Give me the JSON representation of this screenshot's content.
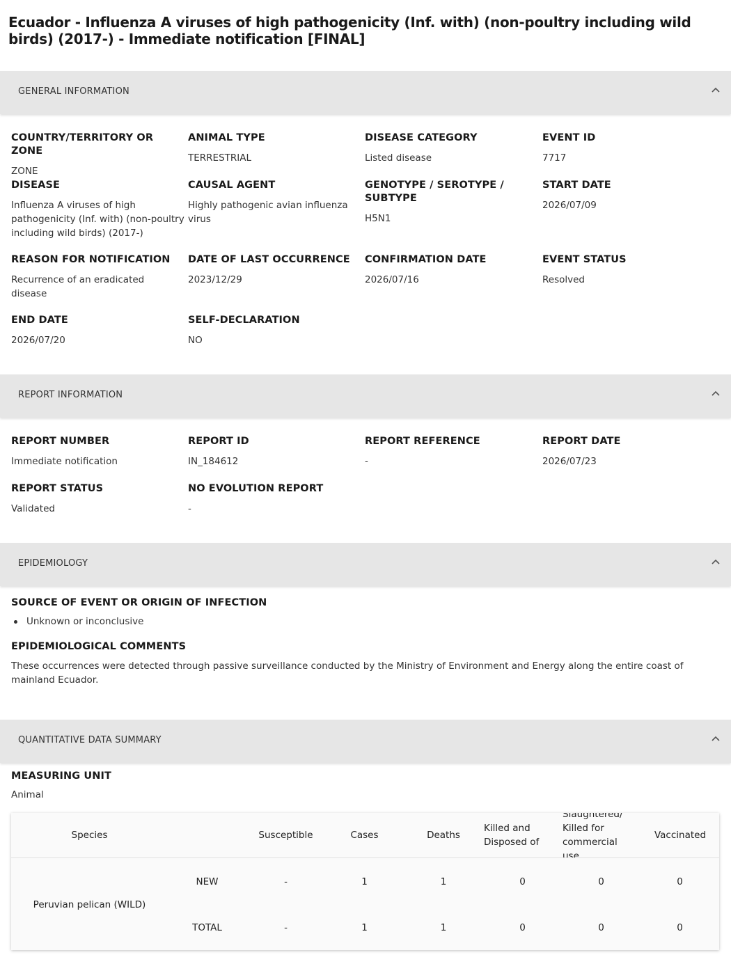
{
  "page": {
    "title": "Ecuador - Influenza A viruses of high pathogenicity (Inf. with) (non-poultry including wild birds) (2017-) - Immediate notification [FINAL]"
  },
  "sections": {
    "general": "GENERAL INFORMATION",
    "report": "REPORT INFORMATION",
    "epidemiology": "EPIDEMIOLOGY",
    "quantitative": "QUANTITATIVE DATA SUMMARY"
  },
  "general": {
    "country": {
      "label": "COUNTRY/TERRITORY OR ZONE",
      "value": "ZONE"
    },
    "animal_type": {
      "label": "ANIMAL TYPE",
      "value": "TERRESTRIAL"
    },
    "disease_category": {
      "label": "DISEASE CATEGORY",
      "value": "Listed disease"
    },
    "event_id": {
      "label": "EVENT ID",
      "value": "7717"
    },
    "disease": {
      "label": "DISEASE",
      "value": "Influenza A viruses of high pathogenicity (Inf. with) (non-poultry including wild birds) (2017-)"
    },
    "causal_agent": {
      "label": "CAUSAL AGENT",
      "value": "Highly pathogenic avian influenza virus"
    },
    "genotype": {
      "label": "GENOTYPE / SEROTYPE / SUBTYPE",
      "value": "H5N1"
    },
    "start_date": {
      "label": "START DATE",
      "value": "2026/07/09"
    },
    "reason": {
      "label": "REASON FOR NOTIFICATION",
      "value": "Recurrence of an eradicated disease"
    },
    "last_occurrence": {
      "label": "DATE OF LAST OCCURRENCE",
      "value": "2023/12/29"
    },
    "confirmation_date": {
      "label": "CONFIRMATION DATE",
      "value": "2026/07/16"
    },
    "event_status": {
      "label": "EVENT STATUS",
      "value": "Resolved"
    },
    "end_date": {
      "label": "END DATE",
      "value": "2026/07/20"
    },
    "self_declaration": {
      "label": "SELF-DECLARATION",
      "value": "NO"
    }
  },
  "report": {
    "number": {
      "label": "REPORT NUMBER",
      "value": "Immediate notification"
    },
    "id": {
      "label": "REPORT ID",
      "value": "IN_184612"
    },
    "reference": {
      "label": "REPORT REFERENCE",
      "value": "-"
    },
    "date": {
      "label": "REPORT DATE",
      "value": "2026/07/23"
    },
    "status": {
      "label": "REPORT STATUS",
      "value": "Validated"
    },
    "no_evolution": {
      "label": "NO EVOLUTION REPORT",
      "value": "-"
    }
  },
  "epidemiology": {
    "source_label": "SOURCE OF EVENT OR ORIGIN OF INFECTION",
    "sources": [
      "Unknown or inconclusive"
    ],
    "comments_label": "EPIDEMIOLOGICAL COMMENTS",
    "comments": "These occurrences were detected through passive surveillance conducted by the Ministry of Environment and Energy along the entire coast of mainland Ecuador."
  },
  "quantitative": {
    "unit_label": "MEASURING UNIT",
    "unit_value": "Animal",
    "headers": {
      "species": "Species",
      "susceptible": "Susceptible",
      "cases": "Cases",
      "deaths": "Deaths",
      "killed": "Killed and Disposed of",
      "slaughtered": "Slaughtered/ Killed for commercial use",
      "vaccinated": "Vaccinated"
    },
    "species": "Peruvian pelican (WILD)",
    "rows": [
      {
        "type": "NEW",
        "susceptible": "-",
        "cases": "1",
        "deaths": "1",
        "killed": "0",
        "slaughtered": "0",
        "vaccinated": "0"
      },
      {
        "type": "TOTAL",
        "susceptible": "-",
        "cases": "1",
        "deaths": "1",
        "killed": "0",
        "slaughtered": "0",
        "vaccinated": "0"
      }
    ]
  },
  "icons": {
    "collapse": "chevron-up-icon"
  }
}
